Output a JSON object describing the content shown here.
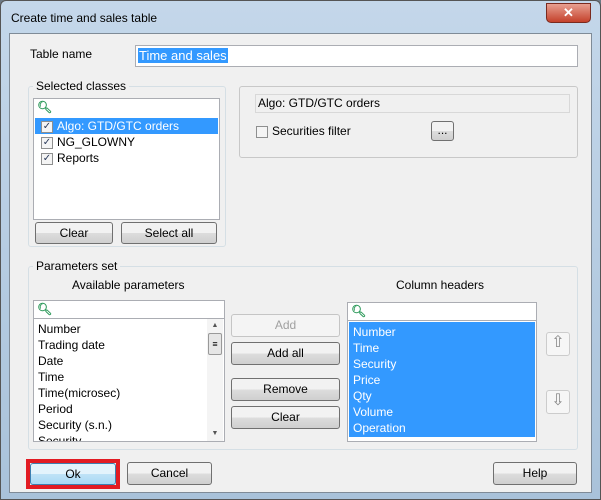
{
  "window": {
    "title": "Create time and sales table",
    "close": "✕"
  },
  "table_name": {
    "label": "Table name",
    "value": "Time and sales"
  },
  "selected_classes": {
    "label": "Selected classes",
    "items": [
      {
        "label": "Algo: GTD/GTC orders",
        "checked": true,
        "selected": true
      },
      {
        "label": "NG_GLOWNY",
        "checked": true,
        "selected": false
      },
      {
        "label": "Reports",
        "checked": true,
        "selected": false
      }
    ],
    "clear": "Clear",
    "select_all": "Select all"
  },
  "class_details": {
    "current_class": "Algo: GTD/GTC orders",
    "securities_filter": "Securities filter",
    "securities_filter_checked": false,
    "browse": "..."
  },
  "parameters": {
    "label": "Parameters set",
    "available_header": "Available parameters",
    "columns_header": "Column headers",
    "available": [
      "Number",
      "Trading date",
      "Date",
      "Time",
      "Time(microsec)",
      "Period",
      "Security (s.n.)",
      "Security"
    ],
    "columns": [
      "Number",
      "Time",
      "Security",
      "Price",
      "Qty",
      "Volume",
      "Operation"
    ],
    "add": "Add",
    "add_all": "Add all",
    "remove": "Remove",
    "clear": "Clear",
    "up": "⇧",
    "down": "⇩"
  },
  "footer": {
    "ok": "Ok",
    "cancel": "Cancel",
    "help": "Help"
  },
  "colors": {
    "selection": "#3399ff",
    "highlight_border": "#e21b23"
  }
}
